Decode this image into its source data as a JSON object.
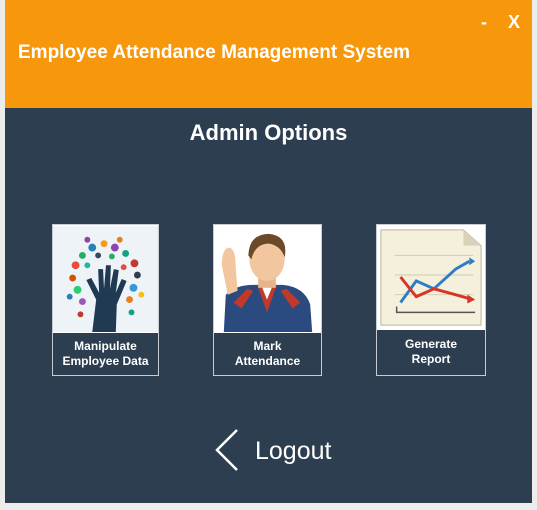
{
  "window": {
    "title": "Employee Attendance Management System",
    "minimize_label": "-",
    "close_label": "X"
  },
  "main": {
    "heading": "Admin Options",
    "tiles": [
      {
        "label": "Manipulate\nEmployee Data",
        "icon": "hand-tree-icon"
      },
      {
        "label": "Mark\nAttendance",
        "icon": "waving-man-icon"
      },
      {
        "label": "Generate\nReport",
        "icon": "line-chart-report-icon"
      }
    ],
    "logout_label": "Logout"
  },
  "colors": {
    "titlebar": "#f7970b",
    "background": "#2c3e50",
    "text": "#ffffff"
  }
}
